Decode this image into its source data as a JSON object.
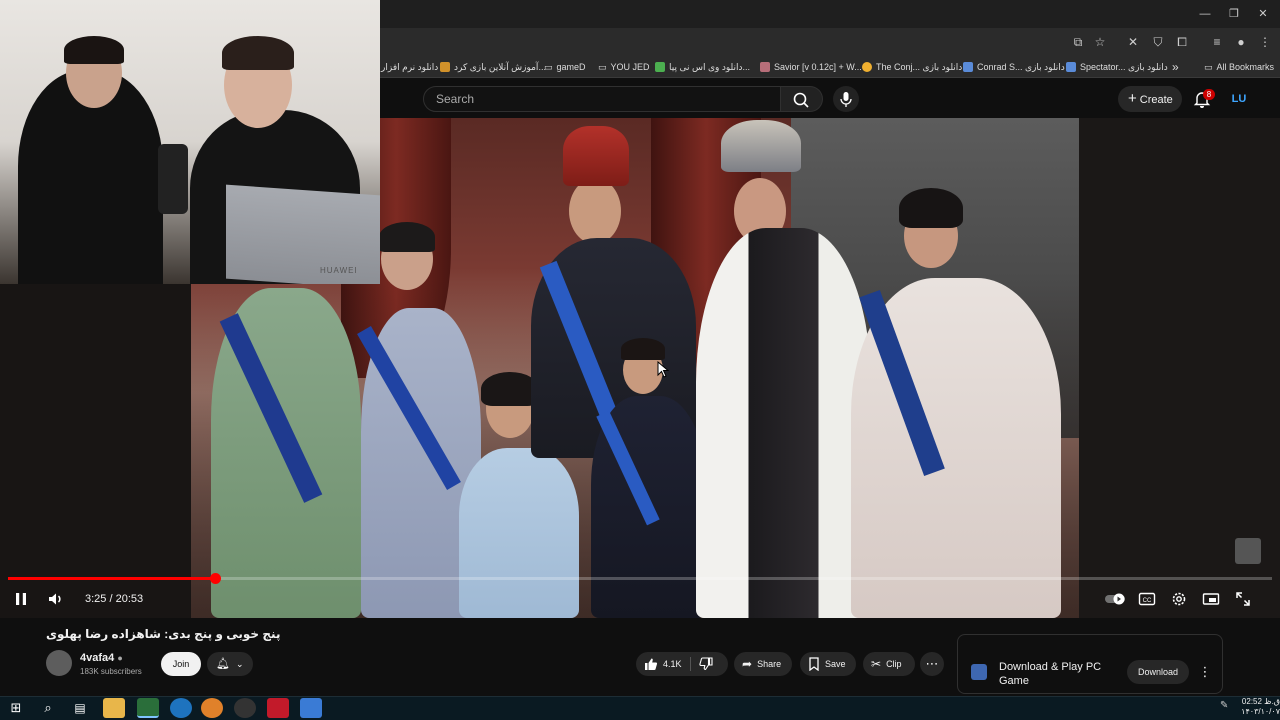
{
  "browser": {
    "window_controls": [
      "—",
      "❐",
      "✕"
    ],
    "bookmarks": [
      {
        "label": "دانلود نرم افزار",
        "color": "#e8a23a"
      },
      {
        "label": "آموزش آنلاین بازی کرد...",
        "color": "#d1912a"
      },
      {
        "label": "gameD",
        "color": "#cccccc"
      },
      {
        "label": "YOU JED",
        "color": "#cccccc"
      },
      {
        "label": "دانلود وی اس نی پیا...",
        "color": "#4caf50"
      },
      {
        "label": "Savior [v 0.12c] + W...",
        "color": "#b76e79"
      },
      {
        "label": "The Conj... دانلود بازی",
        "color": "#f0b030"
      },
      {
        "label": "Conrad S... دانلود بازی",
        "color": "#5a8bd8"
      },
      {
        "label": "Spectator... دانلود بازی",
        "color": "#5a8bd8"
      }
    ],
    "bookmarks_overflow": "»",
    "all_bookmarks": "All Bookmarks"
  },
  "header": {
    "search_placeholder": "Search",
    "create_label": "Create",
    "notification_count": "8",
    "account_initials": "LU"
  },
  "player": {
    "timecode": "3:25 / 20:53",
    "progress_fraction": 0.164,
    "is_playing": true
  },
  "video": {
    "title": "پنج خوبی و پنج بدی: شاهزاده رضا پهلوی",
    "channel_name": "4vafa4",
    "subscribers": "183K subscribers",
    "join_label": "Join",
    "like_count": "4.1K",
    "share_label": "Share",
    "save_label": "Save",
    "clip_label": "Clip"
  },
  "ad": {
    "title": "Download & Play PC Game",
    "button": "Download"
  },
  "webcam": {
    "laptop_brand": "HUAWEI"
  },
  "taskbar": {
    "clock_time": "02:52 ق.ظ",
    "clock_date": "۱۴۰۳/۱۰/۰۷"
  },
  "colors": {
    "accent_red": "#ff0000",
    "youtube_bg": "#0f0f0f",
    "link_blue": "#3ea6ff"
  }
}
